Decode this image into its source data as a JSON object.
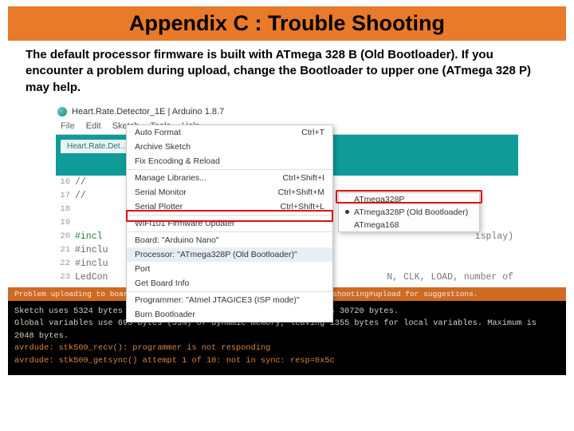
{
  "title": "Appendix C : Trouble Shooting",
  "bodytext": "The default processor firmware is built with ATmega 328 B (Old Bootloader). If you encounter a problem during upload, change the Bootloader to upper one (ATmega 328 P) may help.",
  "window": {
    "title": "Heart.Rate.Detector_1E | Arduino 1.8.7"
  },
  "menubar": {
    "file": "File",
    "edit": "Edit",
    "sketch": "Sketch",
    "tools": "Tools",
    "help": "Help"
  },
  "tab": "Heart.Rate.Det…",
  "code": {
    "l16": "16",
    "c16": "//",
    "l17": "17",
    "c17": "//",
    "l18": "18",
    "c18": "",
    "l19": "19",
    "c19": "",
    "l20": "20",
    "c20a": "#incl",
    "c20b": "isplay)",
    "l21": "21",
    "c21": "#inclu",
    "l22": "22",
    "c22": "#inclu",
    "l23": "23",
    "c23a": "LedCon",
    "c23b": "N, CLK, LOAD, number of"
  },
  "dropdown": {
    "auto": {
      "label": "Auto Format",
      "key": "Ctrl+T"
    },
    "archive": {
      "label": "Archive Sketch",
      "key": ""
    },
    "fix": {
      "label": "Fix Encoding & Reload",
      "key": ""
    },
    "lib": {
      "label": "Manage Libraries...",
      "key": "Ctrl+Shift+I"
    },
    "mon": {
      "label": "Serial Monitor",
      "key": "Ctrl+Shift+M"
    },
    "plot": {
      "label": "Serial Plotter",
      "key": "Ctrl+Shift+L"
    },
    "wifi": {
      "label": "WiFi101 Firmware Updater",
      "key": ""
    },
    "board": {
      "label": "Board: \"Arduino Nano\"",
      "key": ""
    },
    "proc": {
      "label": "Processor: \"ATmega328P (Old Bootloader)\"",
      "key": ""
    },
    "port": {
      "label": "Port",
      "key": ""
    },
    "getinfo": {
      "label": "Get Board Info",
      "key": ""
    },
    "prog": {
      "label": "Programmer: \"Atmel JTAGICE3 (ISP mode)\"",
      "key": ""
    },
    "burn": {
      "label": "Burn Bootloader",
      "key": ""
    }
  },
  "submenu": {
    "p1": "ATmega328P",
    "p2": "ATmega328P (Old Bootloader)",
    "p3": "ATmega168"
  },
  "errbar": "Problem uploading to board.  See http://www.arduino.cc/en/Guide/Troubleshooting#upload for suggestions.",
  "term": {
    "t1": "Sketch uses 5324 bytes (17%) of program storage space. Maximum is 30720 bytes.",
    "t2": "Global variables use 693 bytes (33%) of dynamic memory, leaving 1355 bytes for local variables. Maximum is 2048 bytes.",
    "t3": "avrdude: stk500_recv(): programmer is not responding",
    "t4": "avrdude: stk500_getsync() attempt 1 of 10: not in sync: resp=0x5c"
  }
}
